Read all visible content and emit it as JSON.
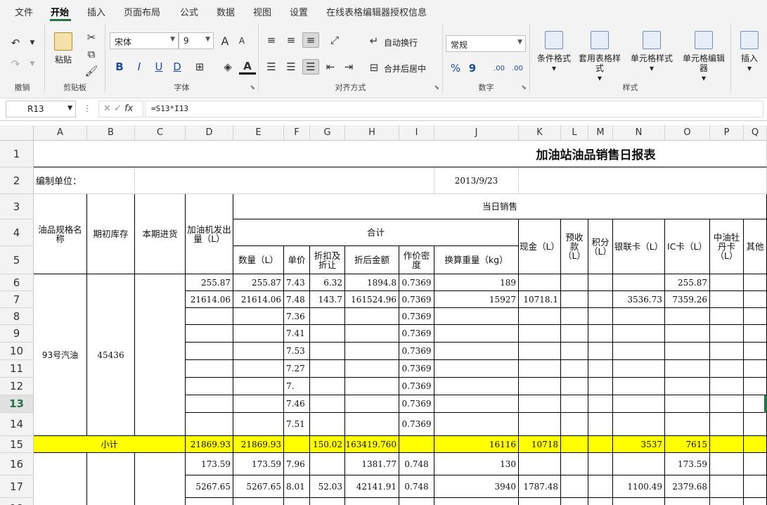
{
  "menu": [
    "文件",
    "开始",
    "插入",
    "页面布局",
    "公式",
    "数据",
    "视图",
    "设置",
    "在线表格编辑器授权信息"
  ],
  "ribbon": {
    "undo_group": "撤销",
    "clipboard_group": "剪贴板",
    "paste_label": "粘贴",
    "font_group": "字体",
    "font_name": "宋体",
    "font_size": "9",
    "align_group": "对齐方式",
    "wrap_label": "自动换行",
    "merge_label": "合并后居中",
    "number_group": "数字",
    "number_format": "常规",
    "styles_group": "样式",
    "cond_format": "条件格式",
    "table_style": "套用表格样式",
    "cell_style": "单元格样式",
    "cell_editor": "单元格编辑器",
    "insert_label": "插入",
    "glyph_bold": "B",
    "glyph_italic": "I",
    "glyph_underline": "U",
    "glyph_double": "D",
    "glyph_pct": "%",
    "glyph_comma": "9",
    "glyph_inc": ".00",
    "glyph_dec": ".00",
    "glyph_fontA": "A",
    "glyph_fontA2": "A"
  },
  "namebox": "R13",
  "fx_label": "fx",
  "formula": "=S13*I13",
  "columns": [
    "A",
    "B",
    "C",
    "D",
    "E",
    "F",
    "G",
    "H",
    "I",
    "J",
    "K",
    "L",
    "M",
    "N",
    "O",
    "P",
    "Q"
  ],
  "rows": [
    "1",
    "2",
    "3",
    "4",
    "5",
    "6",
    "7",
    "8",
    "9",
    "10",
    "11",
    "12",
    "13",
    "14",
    "15",
    "16",
    "17",
    "18"
  ],
  "sheet": {
    "title": "加油站油品销售日报表",
    "unit_label": "编制单位：",
    "date": "2013/9/23",
    "h_spec": "油品规格名称",
    "h_open": "期初库存",
    "h_in": "本期进货",
    "h_pump": "加油机发出量（L）",
    "h_daily": "当日销售",
    "h_total": "合计",
    "h_qty": "数量（L）",
    "h_price": "单价",
    "h_disc": "折扣及折让",
    "h_amt": "折后金额",
    "h_dens": "作价密度",
    "h_wt": "换算重量（kg）",
    "h_cash": "现金（L）",
    "h_pre": "预收款（L）",
    "h_pts": "积分（L）",
    "h_union": "银联卡（L）",
    "h_ic": "IC卡（L）",
    "h_peony": "中油牡丹卡（L）",
    "h_other": "其他",
    "product": "93号汽油",
    "opening": "45436",
    "subtotal_label": "小计",
    "r6": {
      "D": "255.87",
      "E": "255.87",
      "F": "7.43",
      "G": "6.32",
      "H": "1894.8",
      "I": "0.7369",
      "J": "189",
      "O": "255.87"
    },
    "r7": {
      "D": "21614.06",
      "E": "21614.06",
      "F": "7.48",
      "G": "143.7",
      "H": "161524.96",
      "I": "0.7369",
      "J": "15927",
      "K": "10718.1",
      "N": "3536.73",
      "O": "7359.26"
    },
    "r8": {
      "F": "7.36",
      "I": "0.7369"
    },
    "r9": {
      "F": "7.41",
      "I": "0.7369"
    },
    "r10": {
      "F": "7.53",
      "I": "0.7369"
    },
    "r11": {
      "F": "7.27",
      "I": "0.7369"
    },
    "r12": {
      "F": "7.",
      "I": "0.7369"
    },
    "r13": {
      "F": "7.46",
      "I": "0.7369"
    },
    "r14": {
      "F": "7.51",
      "I": "0.7369"
    },
    "r15": {
      "D": "21869.93",
      "E": "21869.93",
      "G": "150.02",
      "H": "163419.760",
      "J": "16116",
      "K": "10718",
      "N": "3537",
      "O": "7615"
    },
    "r16": {
      "D": "173.59",
      "E": "173.59",
      "F": "7.96",
      "H": "1381.77",
      "I": "0.748",
      "J": "130",
      "O": "173.59"
    },
    "r17": {
      "D": "5267.65",
      "E": "5267.65",
      "F": "8.01",
      "G": "52.03",
      "H": "42141.91",
      "I": "0.748",
      "J": "3940",
      "K": "1787.48",
      "N": "1100.49",
      "O": "2379.68"
    }
  },
  "colors": {
    "accent": "#217346",
    "highlight": "#ffff00"
  }
}
